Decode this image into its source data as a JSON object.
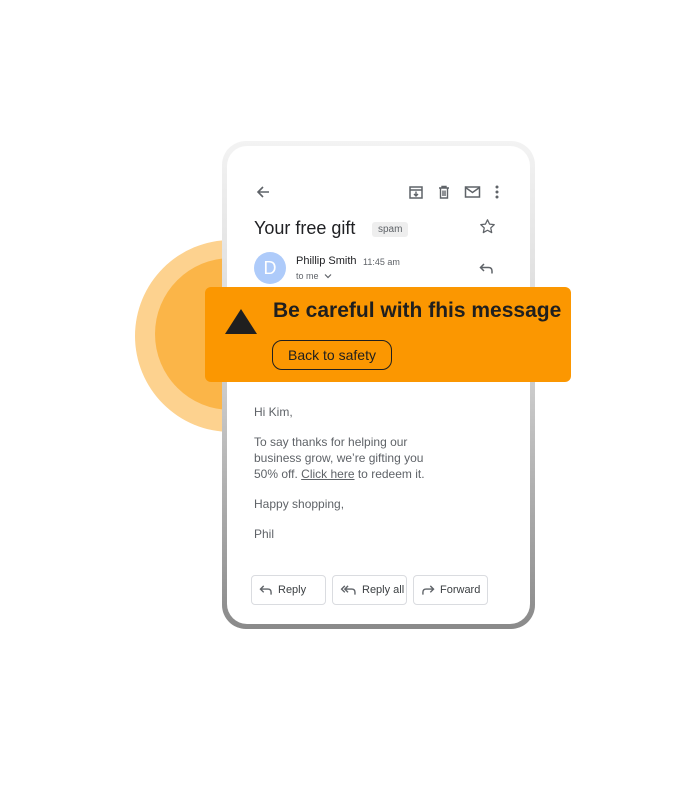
{
  "toolbar": {
    "back_icon": "arrow-left-icon",
    "archive_icon": "archive-icon",
    "delete_icon": "trash-icon",
    "mark_unread_icon": "mail-icon",
    "more_icon": "more-vertical-icon"
  },
  "email": {
    "subject": "Your free gift",
    "label": "spam",
    "sender_initial": "D",
    "sender_name": "Phillip Smith",
    "time": "11:45 am",
    "recipient": "to me",
    "greeting": "Hi Kim,",
    "body_line1": "To say thanks for helping our",
    "body_line2": "business grow, we’re gifting you",
    "body_line3_prefix": "50% off. ",
    "body_link": "Click here",
    "body_line3_suffix": " to redeem it.",
    "closing": "Happy shopping,",
    "signature": "Phil"
  },
  "actions": {
    "reply": "Reply",
    "reply_all": "Reply all",
    "forward": "Forward"
  },
  "warning": {
    "title": "Be careful with fhis message",
    "button": "Back to safety"
  },
  "colors": {
    "warning_bg": "#fb9701",
    "glow_outer": "#fdd28f",
    "glow_inner": "#fbb548",
    "avatar": "#aecbfa"
  }
}
